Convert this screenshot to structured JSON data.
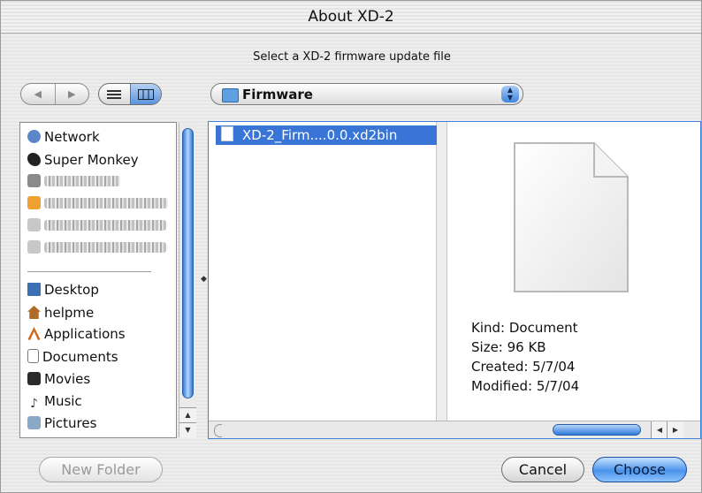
{
  "window": {
    "title": "About XD-2"
  },
  "prompt": "Select a XD-2 firmware update file",
  "toolbar": {
    "back_icon": "back-arrow-icon",
    "forward_icon": "forward-arrow-icon",
    "list_view_icon": "list-view-icon",
    "column_view_icon": "column-view-icon",
    "location": "Firmware"
  },
  "sidebar": {
    "items": [
      {
        "label": "Network",
        "icon": "globe-icon",
        "color": "#5b86c8"
      },
      {
        "label": "Super Monkey",
        "icon": "monkey-icon",
        "color": "#222222"
      },
      {
        "label": "",
        "icon": "disk-icon",
        "color": "#8a8a8a",
        "obscured": true
      },
      {
        "label": "",
        "icon": "disk-icon",
        "color": "#f0a030",
        "obscured": true
      },
      {
        "label": "",
        "icon": "disk-icon",
        "color": "#c0c0c0",
        "obscured": true
      },
      {
        "label": "",
        "icon": "disk-icon",
        "color": "#c0c0c0",
        "obscured": true
      },
      {
        "label": "Desktop",
        "icon": "desktop-icon",
        "color": "#3d6fb3"
      },
      {
        "label": "helpme",
        "icon": "home-icon",
        "color": "#b06a2a"
      },
      {
        "label": "Applications",
        "icon": "applications-icon",
        "color": "#d06a1a"
      },
      {
        "label": "Documents",
        "icon": "documents-icon",
        "color": "#9a9a9a"
      },
      {
        "label": "Movies",
        "icon": "movies-icon",
        "color": "#2a2a2a"
      },
      {
        "label": "Music",
        "icon": "music-icon",
        "color": "#444444"
      },
      {
        "label": "Pictures",
        "icon": "pictures-icon",
        "color": "#8aa9c8"
      }
    ]
  },
  "browser": {
    "selected_file": "XD-2_Firm....0.0.xd2bin",
    "preview": {
      "kind": "Kind: Document",
      "size": "Size: 96 KB",
      "created": "Created: 5/7/04",
      "modified": "Modified: 5/7/04"
    }
  },
  "buttons": {
    "new_folder": "New Folder",
    "cancel": "Cancel",
    "choose": "Choose"
  },
  "colors": {
    "accent": "#3875d7",
    "selection": "#3875d7"
  }
}
